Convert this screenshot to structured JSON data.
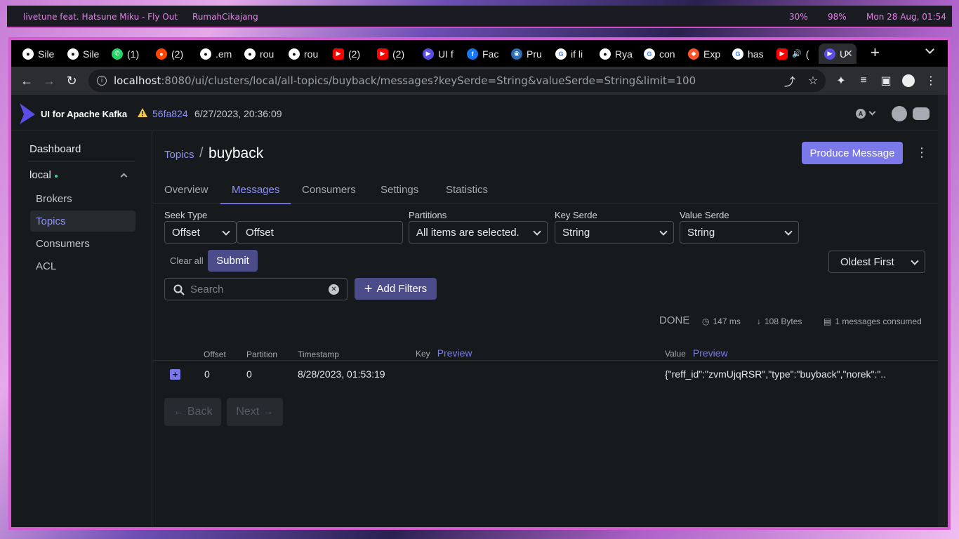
{
  "statusbar": {
    "now_playing": "livetune feat. Hatsune Miku - Fly Out",
    "network": "RumahCikajang",
    "cpu": "30%",
    "battery": "98%",
    "datetime": "Mon 28 Aug, 01:54"
  },
  "browser": {
    "tabs": [
      {
        "label": "Sile",
        "icon": "github-icon"
      },
      {
        "label": "Sile",
        "icon": "github-icon"
      },
      {
        "label": "(1)",
        "icon": "whatsapp-icon"
      },
      {
        "label": "(2)",
        "icon": "reddit-icon"
      },
      {
        "label": ".em",
        "icon": "github-icon"
      },
      {
        "label": "rou",
        "icon": "github-icon"
      },
      {
        "label": "rou",
        "icon": "github-icon"
      },
      {
        "label": "(2)",
        "icon": "youtube-icon"
      },
      {
        "label": "(2)",
        "icon": "youtube-icon"
      },
      {
        "label": "UI f",
        "icon": "kafka-ui-icon"
      },
      {
        "label": "Fac",
        "icon": "facebook-icon"
      },
      {
        "label": "Pru",
        "icon": "globe-icon"
      },
      {
        "label": "if li",
        "icon": "google-icon"
      },
      {
        "label": "Rya",
        "icon": "github-icon"
      },
      {
        "label": "con",
        "icon": "google-icon"
      },
      {
        "label": "Exp",
        "icon": "brave-icon"
      },
      {
        "label": "has",
        "icon": "google-icon"
      },
      {
        "label": "(",
        "icon": "youtube-icon"
      },
      {
        "label": "U",
        "icon": "kafka-ui-icon"
      }
    ],
    "url_host": "localhost",
    "url_rest": ":8080/ui/clusters/local/all-topics/buyback/messages?keySerde=String&valueSerde=String&limit=100"
  },
  "app": {
    "brand": "UI for Apache Kafka",
    "version": "56fa824",
    "version_date": "6/27/2023, 20:36:09",
    "sidebar": {
      "dashboard": "Dashboard",
      "cluster": "local",
      "items": [
        "Brokers",
        "Topics",
        "Consumers",
        "ACL"
      ]
    },
    "breadcrumb": "Topics",
    "topic": "buyback",
    "produce": "Produce Message",
    "tabs": [
      "Overview",
      "Messages",
      "Consumers",
      "Settings",
      "Statistics"
    ],
    "filters": {
      "seek_type_label": "Seek Type",
      "seek_type": "Offset",
      "offset_placeholder": "Offset",
      "partitions_label": "Partitions",
      "partitions": "All items are selected.",
      "key_serde_label": "Key Serde",
      "key_serde": "String",
      "value_serde_label": "Value Serde",
      "value_serde": "String",
      "clear_all": "Clear all",
      "submit": "Submit",
      "sort": "Oldest First",
      "search_placeholder": "Search",
      "add_filters": "Add Filters"
    },
    "stats": {
      "status": "DONE",
      "time": "147 ms",
      "bytes": "108 Bytes",
      "consumed": "1 messages consumed"
    },
    "table": {
      "headers": {
        "offset": "Offset",
        "partition": "Partition",
        "timestamp": "Timestamp",
        "key": "Key",
        "value": "Value",
        "preview": "Preview"
      },
      "rows": [
        {
          "offset": "0",
          "partition": "0",
          "timestamp": "8/28/2023, 01:53:19",
          "value": "{\"reff_id\":\"zvmUjqRSR\",\"type\":\"buyback\",\"norek\":\".."
        }
      ]
    },
    "pager": {
      "back": "← Back",
      "next": "Next →"
    }
  },
  "colors": {
    "accent": "#7b79ea",
    "frame": "#d65ad0"
  }
}
